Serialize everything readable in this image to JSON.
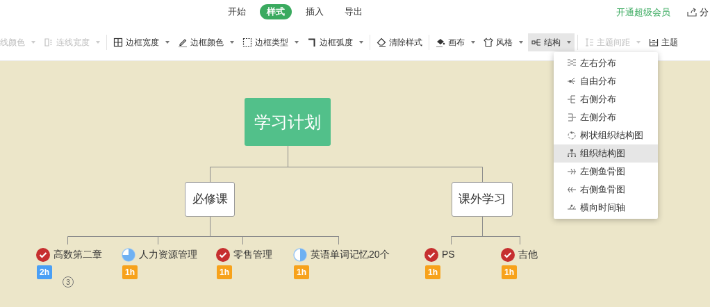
{
  "top_tabs": [
    {
      "label": "开始",
      "selected": false
    },
    {
      "label": "样式",
      "selected": true
    },
    {
      "label": "插入",
      "selected": false
    },
    {
      "label": "导出",
      "selected": false
    }
  ],
  "upgrade_link": "开通超级会员",
  "share_button": "分",
  "toolbar": [
    [
      {
        "label": "线颜色",
        "disabled": true,
        "dropdown": true
      },
      {
        "label": "连线宽度",
        "disabled": true,
        "dropdown": true
      }
    ],
    [
      {
        "label": "边框宽度",
        "disabled": false,
        "dropdown": true
      },
      {
        "label": "边框颜色",
        "disabled": false,
        "dropdown": true
      },
      {
        "label": "边框类型",
        "disabled": false,
        "dropdown": true
      },
      {
        "label": "边框弧度",
        "disabled": false,
        "dropdown": true
      }
    ],
    [
      {
        "label": "清除样式",
        "disabled": false,
        "dropdown": false
      }
    ],
    [
      {
        "label": "画布",
        "disabled": false,
        "dropdown": true
      },
      {
        "label": "风格",
        "disabled": false,
        "dropdown": true
      },
      {
        "label": "结构",
        "disabled": false,
        "dropdown": true,
        "selected": true
      }
    ],
    [
      {
        "label": "主题间距",
        "disabled": true,
        "dropdown": true
      },
      {
        "label": "主题",
        "disabled": false,
        "dropdown": false
      }
    ]
  ],
  "structure_menu": [
    {
      "label": "左右分布",
      "selected": false
    },
    {
      "label": "自由分布",
      "selected": false
    },
    {
      "label": "右侧分布",
      "selected": false
    },
    {
      "label": "左侧分布",
      "selected": false
    },
    {
      "label": "树状组织结构图",
      "selected": false
    },
    {
      "label": "组织结构图",
      "selected": true
    },
    {
      "label": "左侧鱼骨图",
      "selected": false
    },
    {
      "label": "右侧鱼骨图",
      "selected": false
    },
    {
      "label": "横向时间轴",
      "selected": false
    }
  ],
  "mindmap": {
    "root": "学习计划",
    "branches": [
      {
        "label": "必修课",
        "tasks": [
          {
            "label": "高数第二章",
            "kind": "done",
            "duration": {
              "text": "2h",
              "color": "#4a9ff5"
            },
            "marker": "3"
          },
          {
            "label": "人力资源管理",
            "kind": "threequarters",
            "duration": {
              "text": "1h",
              "color": "#f7a21b"
            }
          },
          {
            "label": "零售管理",
            "kind": "done",
            "duration": {
              "text": "1h",
              "color": "#f7a21b"
            }
          },
          {
            "label": "英语单词记忆20个",
            "kind": "half",
            "duration": {
              "text": "1h",
              "color": "#f7a21b"
            }
          }
        ]
      },
      {
        "label": "课外学习",
        "tasks": [
          {
            "label": "PS",
            "kind": "done",
            "duration": {
              "text": "1h",
              "color": "#f7a21b"
            }
          },
          {
            "label": "吉他",
            "kind": "done",
            "duration": {
              "text": "1h",
              "color": "#f7a21b"
            }
          }
        ]
      }
    ]
  }
}
